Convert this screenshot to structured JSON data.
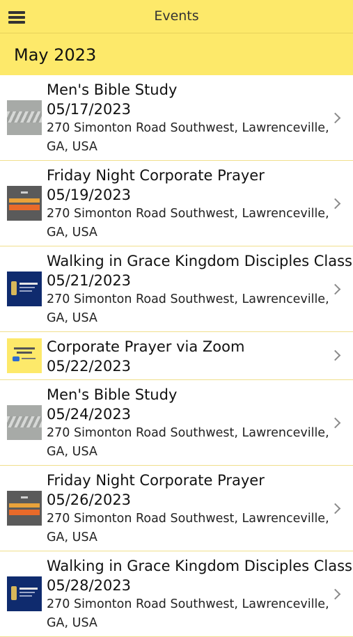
{
  "header": {
    "title": "Events",
    "menu_icon": "hamburger-menu-icon"
  },
  "month": "May 2023",
  "colors": {
    "accent": "#fde96a",
    "divider": "#f0df8c"
  },
  "events": [
    {
      "title": "Men's Bible Study",
      "date": "05/17/2023",
      "address_line1": "270 Simonton Road Southwest, Lawrenceville,",
      "address_line2": "GA, USA",
      "thumbnail": "mens-bible-study"
    },
    {
      "title": "Friday Night Corporate Prayer",
      "date": "05/19/2023",
      "address_line1": "270 Simonton Road Southwest, Lawrenceville,",
      "address_line2": "GA, USA",
      "thumbnail": "corporate-prayer"
    },
    {
      "title": "Walking in Grace Kingdom Disciples Class",
      "date": "05/21/2023",
      "address_line1": "270 Simonton Road Southwest, Lawrenceville,",
      "address_line2": "GA, USA",
      "thumbnail": "tabernacle"
    },
    {
      "title": "Corporate Prayer via Zoom",
      "date": "05/22/2023",
      "thumbnail": "zoom-prayer"
    },
    {
      "title": "Men's Bible Study",
      "date": "05/24/2023",
      "address_line1": "270 Simonton Road Southwest, Lawrenceville,",
      "address_line2": "GA, USA",
      "thumbnail": "mens-bible-study"
    },
    {
      "title": "Friday Night Corporate Prayer",
      "date": "05/26/2023",
      "address_line1": "270 Simonton Road Southwest, Lawrenceville,",
      "address_line2": "GA, USA",
      "thumbnail": "corporate-prayer"
    },
    {
      "title": "Walking in Grace Kingdom Disciples Class",
      "date": "05/28/2023",
      "address_line1": "270 Simonton Road Southwest, Lawrenceville,",
      "address_line2": "GA, USA",
      "thumbnail": "tabernacle"
    }
  ]
}
